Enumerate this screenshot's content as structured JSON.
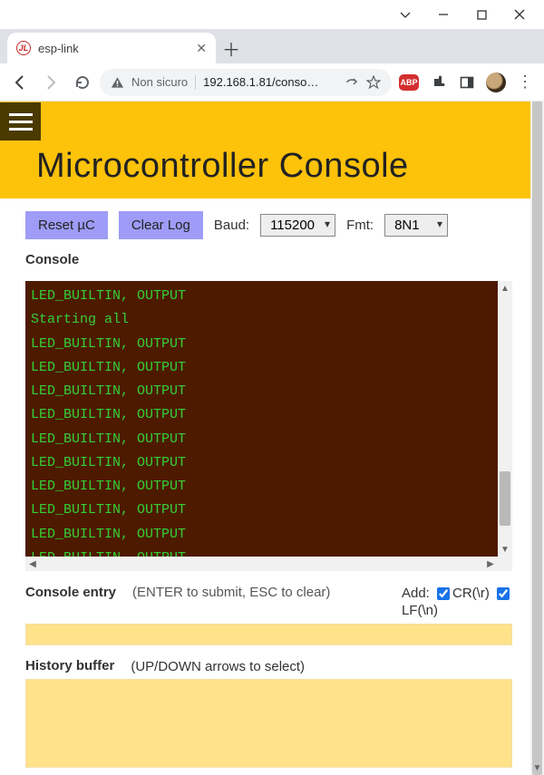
{
  "window": {
    "tab_title": "esp-link",
    "url_display": "192.168.1.81/conso…",
    "security_label": "Non sicuro"
  },
  "page": {
    "title": "Microcontroller Console",
    "buttons": {
      "reset": "Reset µC",
      "clearlog": "Clear Log"
    },
    "baud_label": "Baud:",
    "baud_value": "115200",
    "fmt_label": "Fmt:",
    "fmt_value": "8N1",
    "console_label": "Console",
    "console_lines": [
      "LED_BUILTIN, OUTPUT",
      "Starting all",
      "LED_BUILTIN, OUTPUT",
      "LED_BUILTIN, OUTPUT",
      "LED_BUILTIN, OUTPUT",
      "LED_BUILTIN, OUTPUT",
      "LED_BUILTIN, OUTPUT",
      "LED_BUILTIN, OUTPUT",
      "LED_BUILTIN, OUTPUT",
      "LED_BUILTIN, OUTPUT",
      "LED_BUILTIN, OUTPUT",
      "LED_BUILTIN, OUTPUT"
    ],
    "entry_label": "Console entry",
    "entry_hint": "(ENTER to submit, ESC to clear)",
    "add_label": "Add:",
    "cr_label": "CR(\\r)",
    "lf_label": "LF(\\n)",
    "cr_checked": true,
    "lf_checked": true,
    "history_label": "History buffer",
    "history_hint": "(UP/DOWN arrows to select)"
  }
}
